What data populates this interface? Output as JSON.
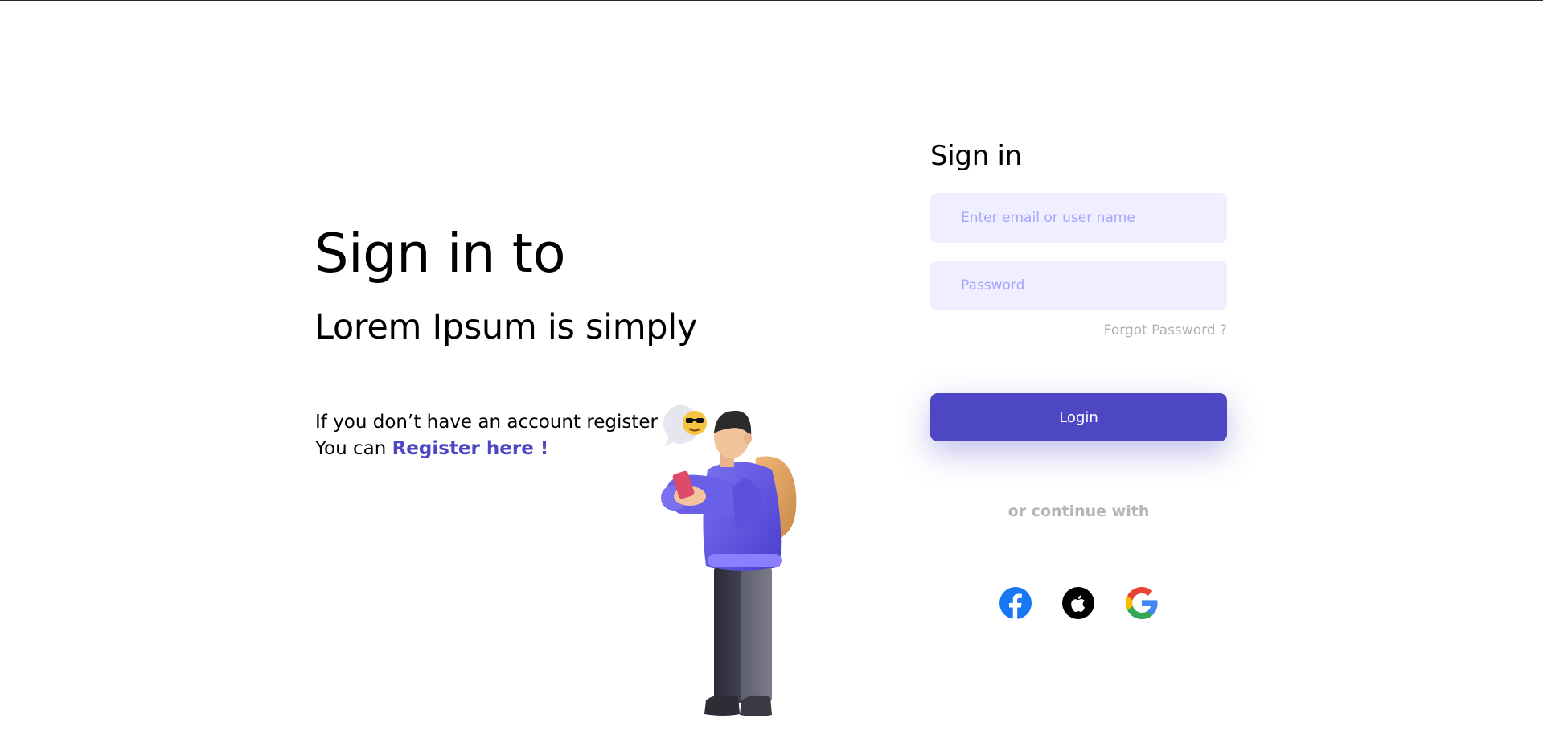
{
  "hero": {
    "title": "Sign in to",
    "subtitle": "Lorem Ipsum is simply",
    "register_line1": "If you don’t have an account register",
    "register_prefix": "You can ",
    "register_link": "Register here !"
  },
  "form": {
    "title": "Sign in",
    "email_placeholder": "Enter email or user name",
    "password_placeholder": "Password",
    "forgot_password": "Forgot Password ?",
    "login_label": "Login",
    "or_continue": "or continue with"
  },
  "social": [
    {
      "name": "facebook",
      "icon": "facebook-icon",
      "color": "#1877f2"
    },
    {
      "name": "apple",
      "icon": "apple-icon",
      "color": "#000000"
    },
    {
      "name": "google",
      "icon": "google-icon",
      "color": "#4285f4"
    }
  ],
  "colors": {
    "accent": "#4d47c3",
    "input_bg": "#f0efff",
    "placeholder": "#a7a3ff",
    "muted": "#b0b0b0"
  }
}
